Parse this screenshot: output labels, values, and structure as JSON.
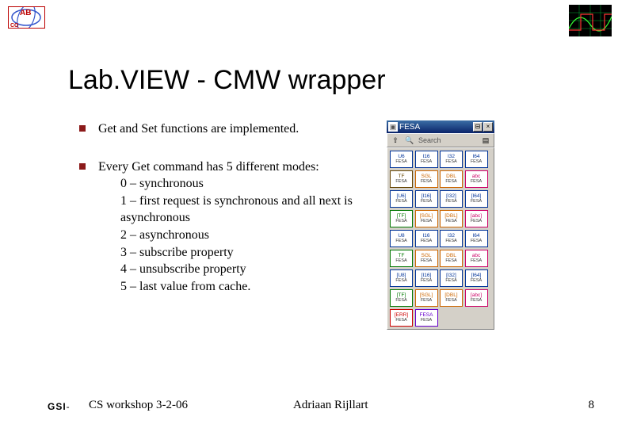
{
  "header": {
    "logo_ab_text": "AB",
    "logo_ab_sub": "CO"
  },
  "title": "Lab.VIEW - CMW wrapper",
  "bullets": [
    {
      "text": "Get and Set functions are implemented."
    },
    {
      "text": "Every Get command has 5 different modes:",
      "subs": [
        "0 – synchronous",
        "1 – first request is synchronous and all next is asynchronous",
        "2 – asynchronous",
        "3 – subscribe property",
        "4 – unsubscribe property",
        "5 – last value from cache."
      ]
    }
  ],
  "panel": {
    "title": "FESA",
    "search_placeholder": "Search",
    "buttons": {
      "min": "_",
      "max": "□",
      "close": "×"
    },
    "grid": [
      [
        {
          "t": "U6",
          "c": "blue"
        },
        {
          "t": "I16",
          "c": "blue"
        },
        {
          "t": "I32",
          "c": "blue"
        },
        {
          "t": "I64",
          "c": "blue"
        }
      ],
      [
        {
          "t": "TF",
          "c": "brown"
        },
        {
          "t": "SGL",
          "c": "orange"
        },
        {
          "t": "DBL",
          "c": "orange"
        },
        {
          "t": "abc",
          "c": "pink"
        }
      ],
      [
        {
          "t": "[U6]",
          "c": "blue"
        },
        {
          "t": "[I16]",
          "c": "blue"
        },
        {
          "t": "[I32]",
          "c": "blue"
        },
        {
          "t": "[I64]",
          "c": "blue"
        }
      ],
      [
        {
          "t": "[TF]",
          "c": "green"
        },
        {
          "t": "[SGL]",
          "c": "orange"
        },
        {
          "t": "[DBL]",
          "c": "orange"
        },
        {
          "t": "[abc]",
          "c": "pink"
        }
      ],
      [
        {
          "t": "U8",
          "c": "blue"
        },
        {
          "t": "I16",
          "c": "blue"
        },
        {
          "t": "I32",
          "c": "blue"
        },
        {
          "t": "I64",
          "c": "blue"
        }
      ],
      [
        {
          "t": "TF",
          "c": "green"
        },
        {
          "t": "SGL",
          "c": "orange"
        },
        {
          "t": "DBL",
          "c": "orange"
        },
        {
          "t": "abc",
          "c": "pink"
        }
      ],
      [
        {
          "t": "[U8]",
          "c": "blue"
        },
        {
          "t": "[I16]",
          "c": "blue"
        },
        {
          "t": "[I32]",
          "c": "blue"
        },
        {
          "t": "[I64]",
          "c": "blue"
        }
      ],
      [
        {
          "t": "[TF]",
          "c": "green"
        },
        {
          "t": "[SGL]",
          "c": "orange"
        },
        {
          "t": "[DBL]",
          "c": "orange"
        },
        {
          "t": "[abc]",
          "c": "pink"
        }
      ],
      [
        {
          "t": "[ERR]",
          "c": "red"
        },
        {
          "t": "FESA",
          "c": "purple"
        },
        {
          "t": "",
          "c": "empty"
        },
        {
          "t": "",
          "c": "empty"
        }
      ]
    ],
    "cell_label": "FESA"
  },
  "footer": {
    "gsi": "GSI",
    "dash": "-",
    "left": "CS workshop 3-2-06",
    "center": "Adriaan Rijllart",
    "page": "8"
  }
}
